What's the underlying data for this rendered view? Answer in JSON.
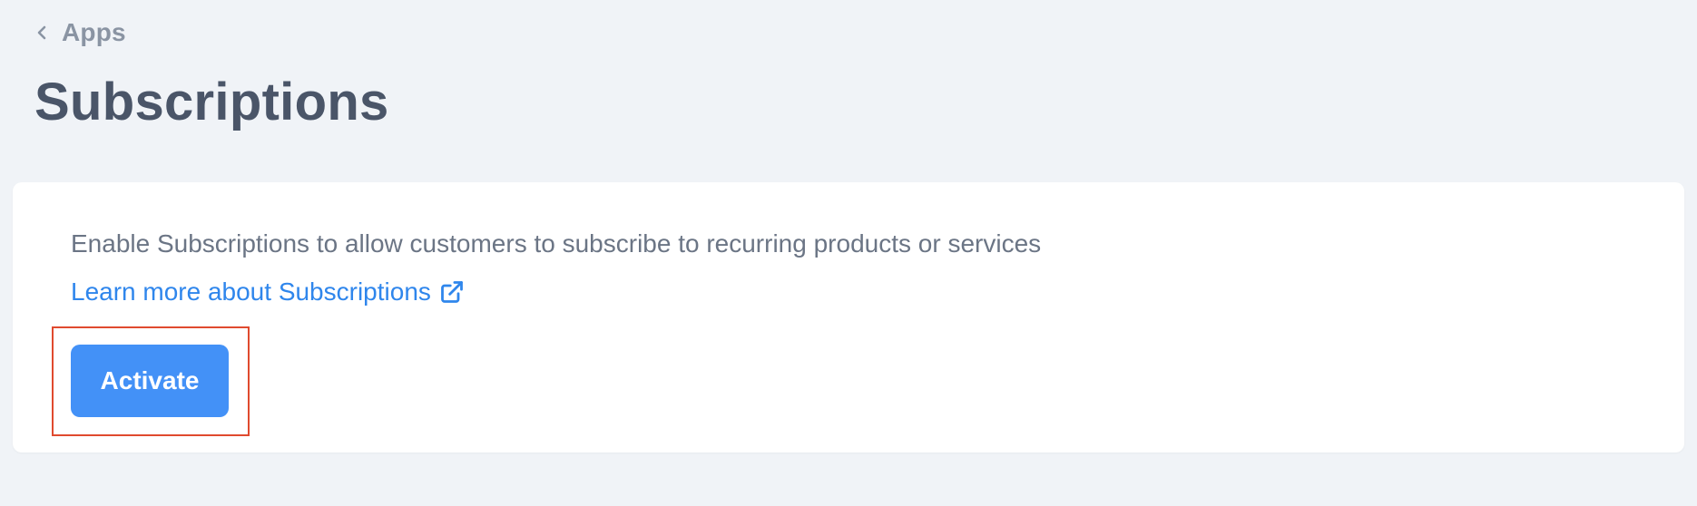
{
  "breadcrumb": {
    "back_icon": "chevron-left-icon",
    "label": "Apps"
  },
  "page_title": "Subscriptions",
  "card": {
    "description": "Enable Subscriptions to allow customers to subscribe to recurring products or services",
    "learn_more": {
      "label": "Learn more about Subscriptions",
      "icon": "external-link-icon"
    },
    "activate_label": "Activate"
  },
  "colors": {
    "background": "#f0f3f7",
    "title": "#4a5568",
    "link": "#2f86ec",
    "button": "#4391f7",
    "highlight": "#e04a2f"
  }
}
